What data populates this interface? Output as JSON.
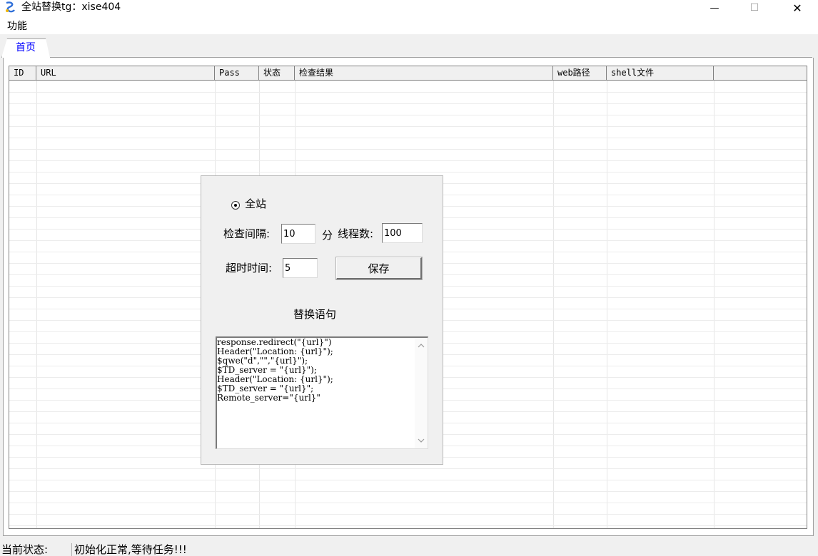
{
  "window": {
    "title": "全站替换tg：xise404",
    "minimize_glyph": "—",
    "maximize_glyph": "☐",
    "close_glyph": "✕"
  },
  "menu": {
    "items": [
      "功能"
    ]
  },
  "tabs": [
    {
      "label": "首页",
      "active": true
    }
  ],
  "grid": {
    "columns": [
      "ID",
      "URL",
      "Pass",
      "状态",
      "检查结果",
      "web路径",
      "shell文件"
    ],
    "rows": []
  },
  "dialog": {
    "radio_label": "全站",
    "interval_label": "检查间隔:",
    "interval_value": "10",
    "interval_unit": "分",
    "threads_label": "线程数:",
    "threads_value": "100",
    "timeout_label": "超时时间:",
    "timeout_value": "5",
    "save_label": "保存",
    "replace_title": "替换语句",
    "replace_lines": [
      "response.redirect(\"{url}\")",
      "Header(\"Location: {url}\");",
      "$qwe(\"d\",\"\",\"{url}\");",
      "$TD_server = \"{url}\");",
      "Header(\"Location: {url}\");",
      "$TD_server = \"{url}\";",
      "Remote_server=\"{url}\""
    ]
  },
  "status": {
    "label": "当前状态:",
    "value": "初始化正常,等待任务!!!"
  },
  "colors": {
    "tab_text": "#0000ff",
    "app_icon": "#3a7bd5"
  }
}
